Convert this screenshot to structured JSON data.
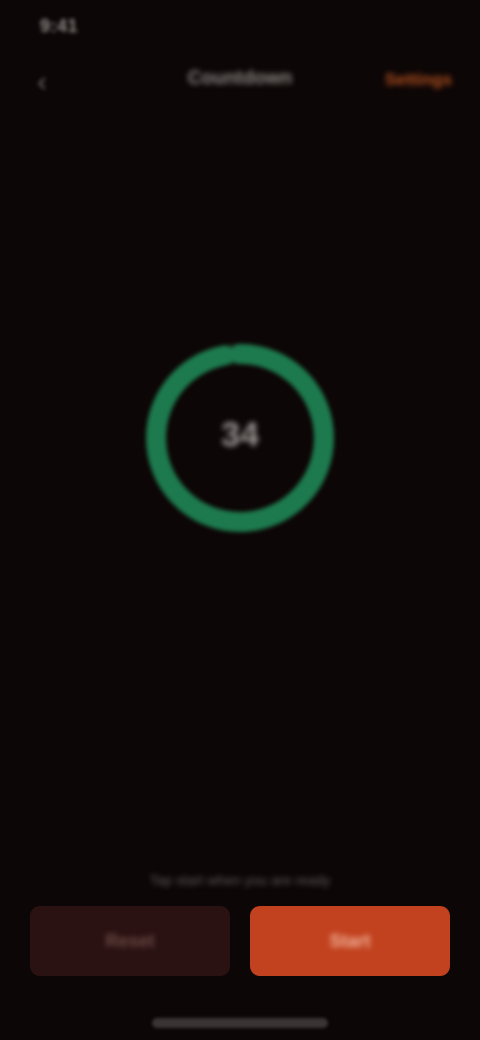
{
  "status_bar": {
    "time": "9:41"
  },
  "nav": {
    "back_icon": "chevron-left-icon",
    "title": "Countdown",
    "action_label": "Settings"
  },
  "timer": {
    "value_text": "34",
    "progress": 0.97,
    "ring_color": "#1d7a4e",
    "track_color": "#1a2a1f"
  },
  "hint": {
    "text": "Tap start when you are ready"
  },
  "buttons": {
    "secondary_label": "Reset",
    "primary_label": "Start"
  },
  "colors": {
    "background": "#0d0606",
    "accent": "#c2421f"
  }
}
